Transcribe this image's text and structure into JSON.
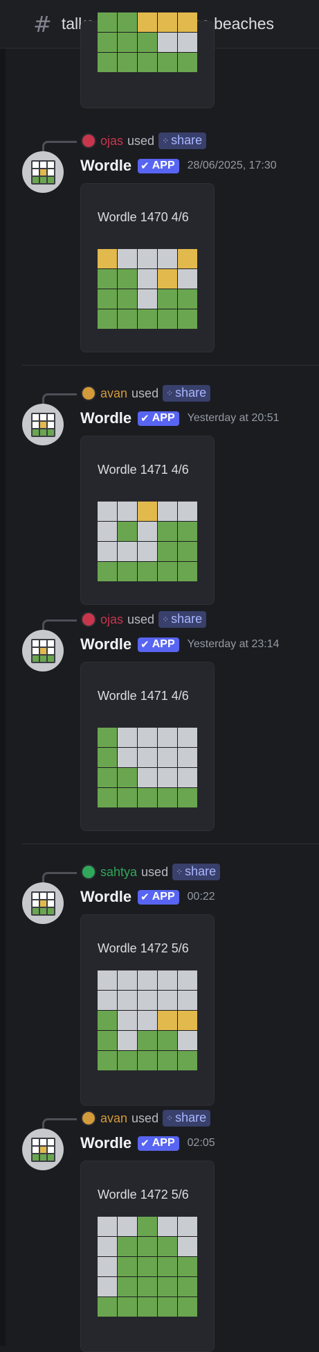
{
  "header": {
    "channel": "talks",
    "thread": "wordles beaches"
  },
  "colors": {
    "green": "#6aa64f",
    "yellow": "#e2b94c",
    "gray": "#c9ccd1",
    "app_badge": "#5865f2"
  },
  "bot": {
    "name": "Wordle",
    "badge": "APP"
  },
  "command": {
    "used": "used",
    "name": "share"
  },
  "top_partial_grid": [
    "GGYYY",
    "GGGWW",
    "GGGGG"
  ],
  "messages": [
    {
      "user": "ojas",
      "user_color": "#c8364d",
      "timestamp": "28/06/2025, 17:30",
      "title": "Wordle 1470 4/6",
      "grid": [
        "YWWWY",
        "GGWYW",
        "GGWGG",
        "GGGGG"
      ]
    },
    {
      "user": "avan",
      "user_color": "#d49b3a",
      "timestamp": "Yesterday at 20:51",
      "title": "Wordle 1471 4/6",
      "grid": [
        "WWYWW",
        "WGWGG",
        "WWWGG",
        "GGGGG"
      ]
    },
    {
      "user": "ojas",
      "user_color": "#c8364d",
      "timestamp": "Yesterday at 23:14",
      "title": "Wordle 1471 4/6",
      "grid": [
        "GWWWW",
        "GWWWW",
        "GGWWW",
        "GGGGG"
      ]
    },
    {
      "user": "sahtya",
      "user_color": "#2fa85a",
      "timestamp": "00:22",
      "title": "Wordle 1472 5/6",
      "grid": [
        "WWWWW",
        "WWWWW",
        "GWWYY",
        "GWGGW",
        "GGGGG"
      ]
    },
    {
      "user": "avan",
      "user_color": "#d49b3a",
      "timestamp": "02:05",
      "title": "Wordle 1472 5/6",
      "grid": [
        "WWGWW",
        "WGGGW",
        "WGGGG",
        "WGGGG",
        "GGGGG"
      ]
    }
  ]
}
